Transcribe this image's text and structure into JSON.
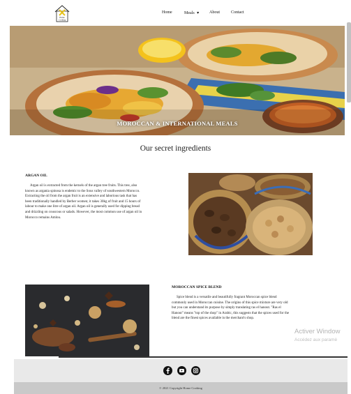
{
  "logo": {
    "line1": "Home",
    "line2": "Cooking"
  },
  "nav": {
    "home": "Home",
    "meals": "Meals",
    "meals_caret": "▾",
    "about": "About",
    "contact": "Contact"
  },
  "hero": {
    "caption": "MOROCCAN & INTERNATIONAL MEALS"
  },
  "section": {
    "title": "Our secret ingredients"
  },
  "argan": {
    "title": "ARGAN OIL",
    "lines": [
      "Argan oil is extracted from the kernels of the argan tree fruits. This tree, also",
      "known as argania spinosa is endemic to the Sous valley of southwestern Morocco.",
      "Extracting the oil from the argan fruit is an extensive and laborious task that has",
      "been traditionally handled by Berber women; it takes 30kg of fruit and 15 hours of",
      "labour to make one litre of argan oil. Argan oil is generally used for dipping bread",
      "and drizzling on couscous or salads. However, the most common use of argan oil in",
      "Morocco remains Amlou."
    ]
  },
  "spice": {
    "title": "MOROCCAN SPICE BLEND",
    "lines": [
      "Spice blend is a versatile and beautifully fragrant Moroccan spice blend",
      "commonly used in Moroccan cuisine. The origins of this spice mixture are very old",
      "but you can understand its purpose by simply translating ras el hanout. \"Ras el",
      "Hanout\" means \"top of the shop\" in Arabic, this suggests that the spices used for the",
      "blend are the finest spices available in the merchant's shop."
    ]
  },
  "watermark": {
    "line1": "Activer Window",
    "line2": "Accédez aux paramè"
  },
  "footer": {
    "copyright": "© 2021 Copyright Home Cooking"
  },
  "colors": {
    "accent_yellow": "#e6c21a",
    "footer_bg": "#e9e9e9",
    "footer_bottom": "#c9c9c9"
  }
}
